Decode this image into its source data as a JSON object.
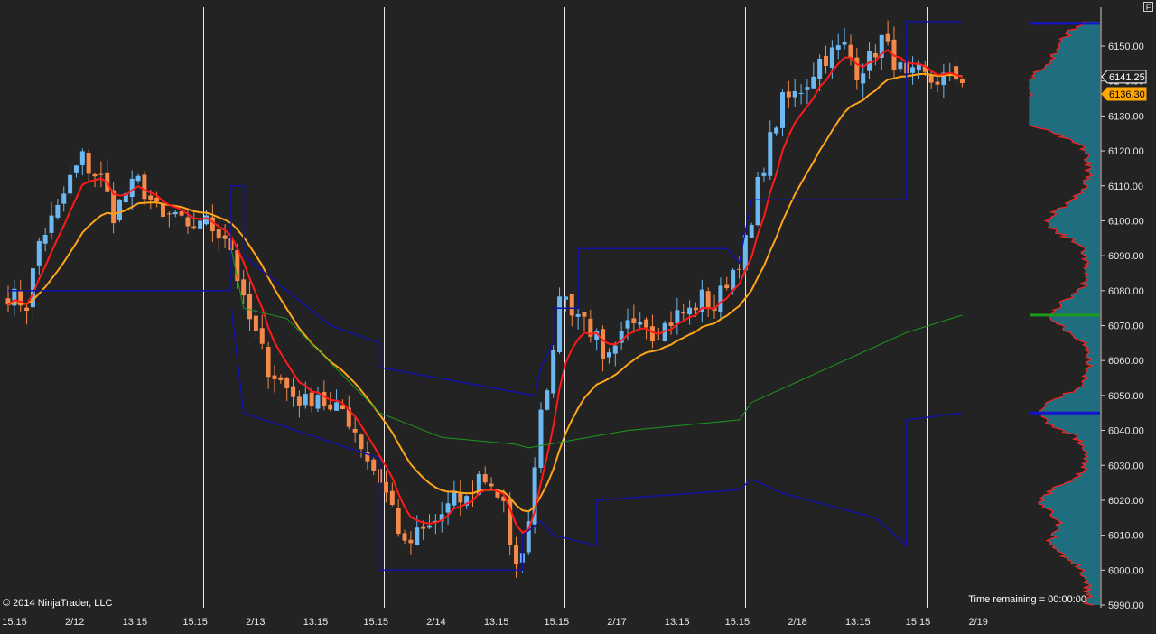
{
  "window": {
    "corner_button_label": "F"
  },
  "chart_data": {
    "type": "candlestick",
    "copyright": "© 2014 NinjaTrader, LLC",
    "time_remaining": "Time remaining = 00:00:00",
    "y_axis": {
      "min": 5990,
      "max": 6155,
      "ticks": [
        "5990.00",
        "6000.00",
        "6010.00",
        "6020.00",
        "6030.00",
        "6040.00",
        "6050.00",
        "6060.00",
        "6070.00",
        "6080.00",
        "6090.00",
        "6100.00",
        "6110.00",
        "6120.00",
        "6130.00",
        "6140.00",
        "6150.00"
      ]
    },
    "x_axis": {
      "labels": [
        "15:15",
        "2/12",
        "13:15",
        "15:15",
        "2/13",
        "13:15",
        "15:15",
        "2/14",
        "13:15",
        "15:15",
        "2/17",
        "13:15",
        "15:15",
        "2/18",
        "13:15",
        "15:15",
        "2/19"
      ]
    },
    "session_breaks_at_label": [
      0,
      3,
      6,
      9,
      12,
      15
    ],
    "price_markers": [
      {
        "label": "6141.25",
        "value": 6141.25,
        "color": "#ffffff"
      },
      {
        "label": "6136.30",
        "value": 6136.3,
        "color": "#ffa500"
      }
    ],
    "colors": {
      "up": "#6cb8f0",
      "down": "#f4894a",
      "fast_ma": "#ff1a1a",
      "slow_ma": "#ffa51a",
      "envelope": "#1212a8",
      "vwap": "#1c9a1c",
      "profile_fill": "#1e6e80",
      "profile_edge": "#ff2020"
    },
    "close_anchors": [
      [
        0,
        6079
      ],
      [
        3,
        6076
      ],
      [
        5,
        6094
      ],
      [
        8,
        6103
      ],
      [
        10,
        6112
      ],
      [
        12,
        6118
      ],
      [
        13,
        6115
      ],
      [
        15,
        6112
      ],
      [
        17,
        6102
      ],
      [
        19,
        6108
      ],
      [
        21,
        6111
      ],
      [
        23,
        6106
      ],
      [
        25,
        6100
      ],
      [
        27,
        6102
      ],
      [
        29,
        6096
      ],
      [
        31,
        6101
      ],
      [
        33,
        6098
      ],
      [
        35,
        6096
      ],
      [
        36,
        6092
      ],
      [
        38,
        6076
      ],
      [
        40,
        6067
      ],
      [
        42,
        6058
      ],
      [
        44,
        6054
      ],
      [
        46,
        6050
      ],
      [
        48,
        6048
      ],
      [
        50,
        6051
      ],
      [
        52,
        6045
      ],
      [
        54,
        6046
      ],
      [
        56,
        6040
      ],
      [
        58,
        6032
      ],
      [
        60,
        6026
      ],
      [
        62,
        6018
      ],
      [
        64,
        6006
      ],
      [
        66,
        6010
      ],
      [
        68,
        6012
      ],
      [
        70,
        6016
      ],
      [
        72,
        6020
      ],
      [
        74,
        6020
      ],
      [
        76,
        6027
      ],
      [
        78,
        6025
      ],
      [
        80,
        6018
      ],
      [
        81,
        6005
      ],
      [
        83,
        6003
      ],
      [
        85,
        6030
      ],
      [
        86,
        6048
      ],
      [
        88,
        6060
      ],
      [
        89,
        6080
      ],
      [
        91,
        6075
      ],
      [
        93,
        6072
      ],
      [
        95,
        6066
      ],
      [
        96,
        6058
      ],
      [
        98,
        6062
      ],
      [
        100,
        6070
      ],
      [
        102,
        6074
      ],
      [
        104,
        6068
      ],
      [
        106,
        6070
      ],
      [
        108,
        6073
      ],
      [
        110,
        6074
      ],
      [
        112,
        6078
      ],
      [
        114,
        6075
      ],
      [
        116,
        6083
      ],
      [
        118,
        6089
      ],
      [
        120,
        6098
      ],
      [
        121,
        6110
      ],
      [
        123,
        6123
      ],
      [
        125,
        6134
      ],
      [
        127,
        6136
      ],
      [
        129,
        6140
      ],
      [
        131,
        6146
      ],
      [
        133,
        6148
      ],
      [
        135,
        6150
      ],
      [
        137,
        6143
      ],
      [
        139,
        6146
      ],
      [
        141,
        6152
      ],
      [
        143,
        6146
      ],
      [
        145,
        6140
      ],
      [
        147,
        6142
      ],
      [
        149,
        6140
      ],
      [
        151,
        6141
      ]
    ],
    "upper_band": [
      [
        0,
        6080
      ],
      [
        36,
        6080
      ],
      [
        36,
        6110
      ],
      [
        38,
        6110
      ],
      [
        38,
        6090
      ],
      [
        52,
        6070
      ],
      [
        60,
        6065
      ],
      [
        60,
        6058
      ],
      [
        85,
        6050
      ],
      [
        86,
        6058
      ],
      [
        88,
        6065
      ],
      [
        88,
        6075
      ],
      [
        92,
        6075
      ],
      [
        92,
        6092
      ],
      [
        116,
        6092
      ],
      [
        118,
        6088
      ],
      [
        120,
        6106
      ],
      [
        145,
        6106
      ],
      [
        145,
        6157
      ],
      [
        154,
        6157
      ]
    ],
    "lower_band": [
      [
        36,
        6075
      ],
      [
        38,
        6045
      ],
      [
        60,
        6032
      ],
      [
        60,
        6000
      ],
      [
        83,
        6000
      ],
      [
        83,
        6010
      ],
      [
        86,
        6014
      ],
      [
        88,
        6010
      ],
      [
        95,
        6007
      ],
      [
        95,
        6020
      ],
      [
        118,
        6023
      ],
      [
        120,
        6026
      ],
      [
        125,
        6022
      ],
      [
        140,
        6015
      ],
      [
        145,
        6007
      ],
      [
        145,
        6043
      ],
      [
        154,
        6045
      ]
    ],
    "vwap": [
      [
        36,
        6092
      ],
      [
        38,
        6075
      ],
      [
        45,
        6072
      ],
      [
        60,
        6045
      ],
      [
        70,
        6038
      ],
      [
        82,
        6036
      ],
      [
        84,
        6035
      ],
      [
        100,
        6040
      ],
      [
        118,
        6043
      ],
      [
        120,
        6048
      ],
      [
        130,
        6056
      ],
      [
        145,
        6068
      ],
      [
        154,
        6073
      ]
    ],
    "profile_highlights": [
      {
        "value": 6156.5,
        "color": "#1212d0"
      },
      {
        "value": 6073,
        "color": "#1c9a1c"
      },
      {
        "value": 6045,
        "color": "#1212d0"
      }
    ]
  }
}
